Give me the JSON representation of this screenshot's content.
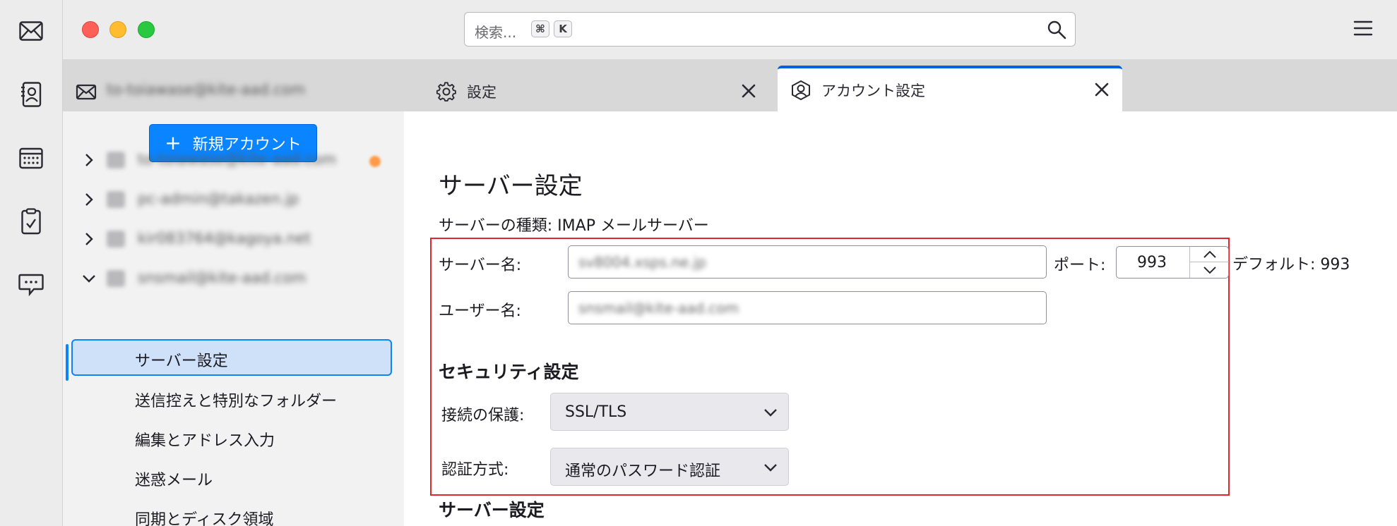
{
  "spaces": {
    "items": [
      {
        "name": "mail",
        "icon": "mail-icon"
      },
      {
        "name": "address-book",
        "icon": "address-book-icon"
      },
      {
        "name": "calendar",
        "icon": "calendar-icon"
      },
      {
        "name": "tasks",
        "icon": "tasks-icon"
      },
      {
        "name": "chat",
        "icon": "chat-icon"
      }
    ]
  },
  "titlebar": {
    "search_placeholder": "検索...",
    "shortcut_key1": "⌘",
    "shortcut_key2": "K"
  },
  "tabs": [
    {
      "label": "to-toiawase@kite-aad.com",
      "icon": "mail-icon"
    },
    {
      "label": "設定",
      "icon": "gear-icon"
    },
    {
      "label": "アカウント設定",
      "icon": "account-icon",
      "active": true
    }
  ],
  "sidebar": {
    "new_account_label": "新規アカウント",
    "accounts": [
      {
        "label": "to-toiawase@kite-aad.com",
        "expanded": false,
        "badge": true
      },
      {
        "label": "pc-admin@takazen.jp",
        "expanded": false
      },
      {
        "label": "kir083764@kagoya.net",
        "expanded": false
      },
      {
        "label": "snsmail@kite-aad.com",
        "expanded": true
      }
    ],
    "sub_items": [
      {
        "label": "サーバー設定",
        "selected": true
      },
      {
        "label": "送信控えと特別なフォルダー"
      },
      {
        "label": "編集とアドレス入力"
      },
      {
        "label": "迷惑メール"
      },
      {
        "label": "同期とディスク領域"
      }
    ]
  },
  "main": {
    "title": "サーバー設定",
    "server_type": "サーバーの種類: IMAP メールサーバー",
    "server_name_label": "サーバー名:",
    "server_name_value": "sv8004.xsps.ne.jp",
    "port_label": "ポート:",
    "port_value": "993",
    "default_port": "デフォルト: 993",
    "username_label": "ユーザー名:",
    "username_value": "snsmail@kite-aad.com",
    "security_heading": "セキュリティ設定",
    "connection_label": "接続の保護:",
    "connection_value": "SSL/TLS",
    "auth_label": "認証方式:",
    "auth_value": "通常のパスワード認証",
    "next_heading": "サーバー設定"
  },
  "colors": {
    "accent": "#0a84ff",
    "highlight_border": "#e0262f",
    "sidebar_bg": "#f2f2f2",
    "selected_bg": "#cfe1f8"
  }
}
